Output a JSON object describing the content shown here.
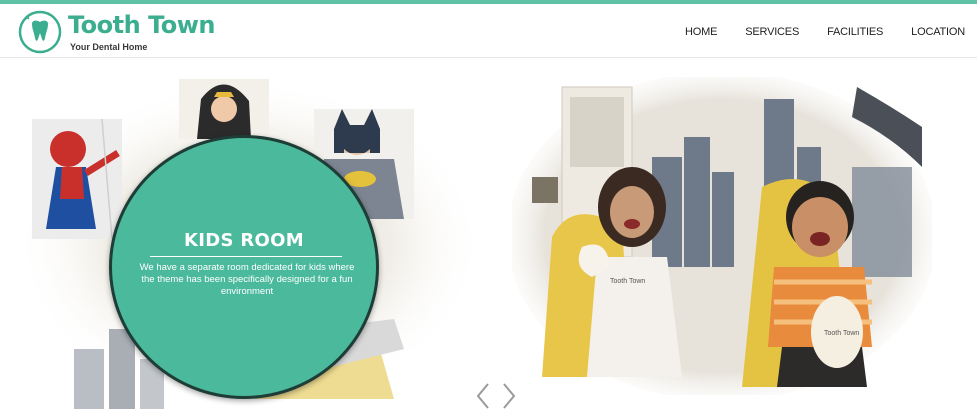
{
  "brand": {
    "name": "Tooth Town",
    "tagline": "Your Dental Home",
    "color": "#3bae8f"
  },
  "nav": {
    "items": [
      "HOME",
      "SERVICES",
      "FACILITIES",
      "LOCATION"
    ]
  },
  "slide": {
    "title": "KIDS ROOM",
    "description": "We have a separate room dedicated for kids where the theme has been specifically designed for a fun environment",
    "circle_color": "#4ab99c"
  },
  "photo_text": {
    "glove_left": "Tooth Town",
    "glove_right": "Tooth Town"
  },
  "controls": {
    "prev_icon": "chevron-left-icon",
    "next_icon": "chevron-right-icon"
  }
}
